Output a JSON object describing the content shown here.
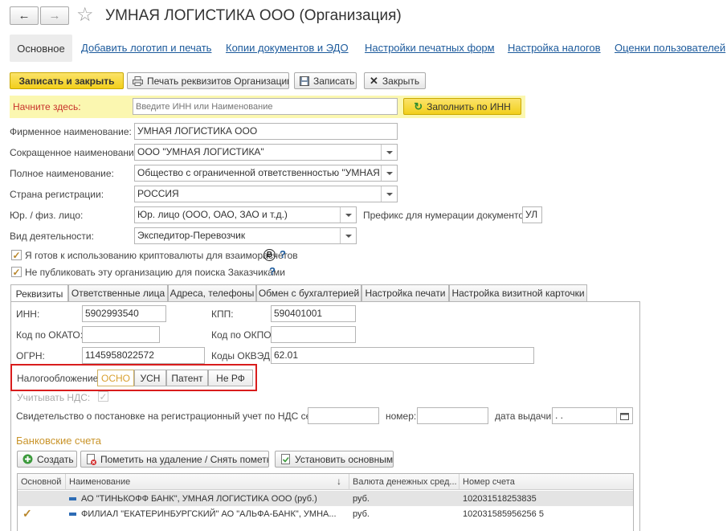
{
  "window": {
    "title": "УМНАЯ ЛОГИСТИКА ООО (Организация)"
  },
  "nav": {
    "back": "←",
    "forward": "→",
    "star": "☆",
    "links": [
      "Основное",
      "Добавить логотип и печать",
      "Копии документов и ЭДО",
      "Настройки печатных форм",
      "Настройка налогов",
      "Оценки пользователей"
    ]
  },
  "toolbar": {
    "save_close": "Записать и закрыть",
    "print_details": "Печать реквизитов Организации",
    "save": "Записать",
    "close": "Закрыть"
  },
  "start": {
    "label": "Начните здесь:",
    "placeholder": "Введите ИНН или Наименование",
    "fill_button": "Заполнить по ИНН"
  },
  "fields": {
    "firm_name": {
      "label": "Фирменное наименование:",
      "value": "УМНАЯ ЛОГИСТИКА ООО"
    },
    "short_name": {
      "label": "Сокращенное наименование:",
      "value": "ООО \"УМНАЯ ЛОГИСТИКА\""
    },
    "full_name": {
      "label": "Полное наименование:",
      "value": "Общество с ограниченной ответственностью \"УМНАЯ ЛОГ"
    },
    "country": {
      "label": "Страна регистрации:",
      "value": "РОССИЯ"
    },
    "entity_type": {
      "label": "Юр. / физ. лицо:",
      "value": "Юр. лицо (ООО, ОАО, ЗАО и т.д.)"
    },
    "prefix": {
      "label": "Префикс для нумерации документов :",
      "value": "УЛ"
    },
    "activity": {
      "label": "Вид деятельности:",
      "value": "Экспедитор-Перевозчик"
    },
    "crypto": {
      "label": "Я готов к использованию криптовалюты для взаиморасчетов",
      "checked": true
    },
    "no_publish": {
      "label": "Не публиковать эту организацию для поиска Заказчиками",
      "checked": true
    },
    "help": "?",
    "bitcoin": "B"
  },
  "tabs": [
    "Реквизиты",
    "Ответственные лица",
    "Адреса, телефоны",
    "Обмен с бухгалтерией",
    "Настройка печати",
    "Настройка визитной карточки"
  ],
  "requisites": {
    "inn": {
      "label": "ИНН:",
      "value": "5902993540"
    },
    "kpp": {
      "label": "КПП:",
      "value": "590401001"
    },
    "okato": {
      "label": "Код по ОКАТО:",
      "value": ""
    },
    "okpo": {
      "label": "Код по ОКПО:",
      "value": ""
    },
    "ogrn": {
      "label": "ОГРН:",
      "value": "1145958022572"
    },
    "okved": {
      "label": "Коды ОКВЭД:",
      "value": "62.01"
    },
    "taxation": {
      "label": "Налогообложение:",
      "options": [
        "ОСНО",
        "УСН",
        "Патент",
        "Не РФ"
      ],
      "selected": "ОСНО"
    },
    "vat": {
      "label": "Учитывать НДС:",
      "checked": true
    },
    "vat_cert": {
      "label": "Свидетельство о постановке на регистрационный учет по НДС серия:",
      "number_label": "номер:",
      "date_label": "дата выдачи:",
      "date_value": ". ."
    }
  },
  "bank": {
    "title": "Банковские счета",
    "buttons": {
      "create": "Создать",
      "mark_delete": "Пометить на удаление / Снять пометку",
      "set_main": "Установить основным"
    },
    "columns": [
      "Основной",
      "Наименование",
      "Валюта денежных сред...",
      "Номер счета"
    ],
    "sort_arrow": "↓",
    "rows": [
      {
        "main": false,
        "name": "АО \"ТИНЬКОФФ БАНК\", УМНАЯ ЛОГИСТИКА ООО (руб.)",
        "currency": "руб.",
        "account": "102031518253835"
      },
      {
        "main": true,
        "name": "ФИЛИАЛ \"ЕКАТЕРИНБУРГСКИЙ\" АО \"АЛЬФА-БАНК\", УМНА...",
        "currency": "руб.",
        "account": "102031585956256 5"
      }
    ]
  },
  "colors": {
    "accent_yellow": "#f5d72a",
    "highlight_border": "#d91c1c",
    "link": "#1c5a9c",
    "selected_row": "#e4e4e4",
    "start_bg": "#fbf7b0"
  }
}
